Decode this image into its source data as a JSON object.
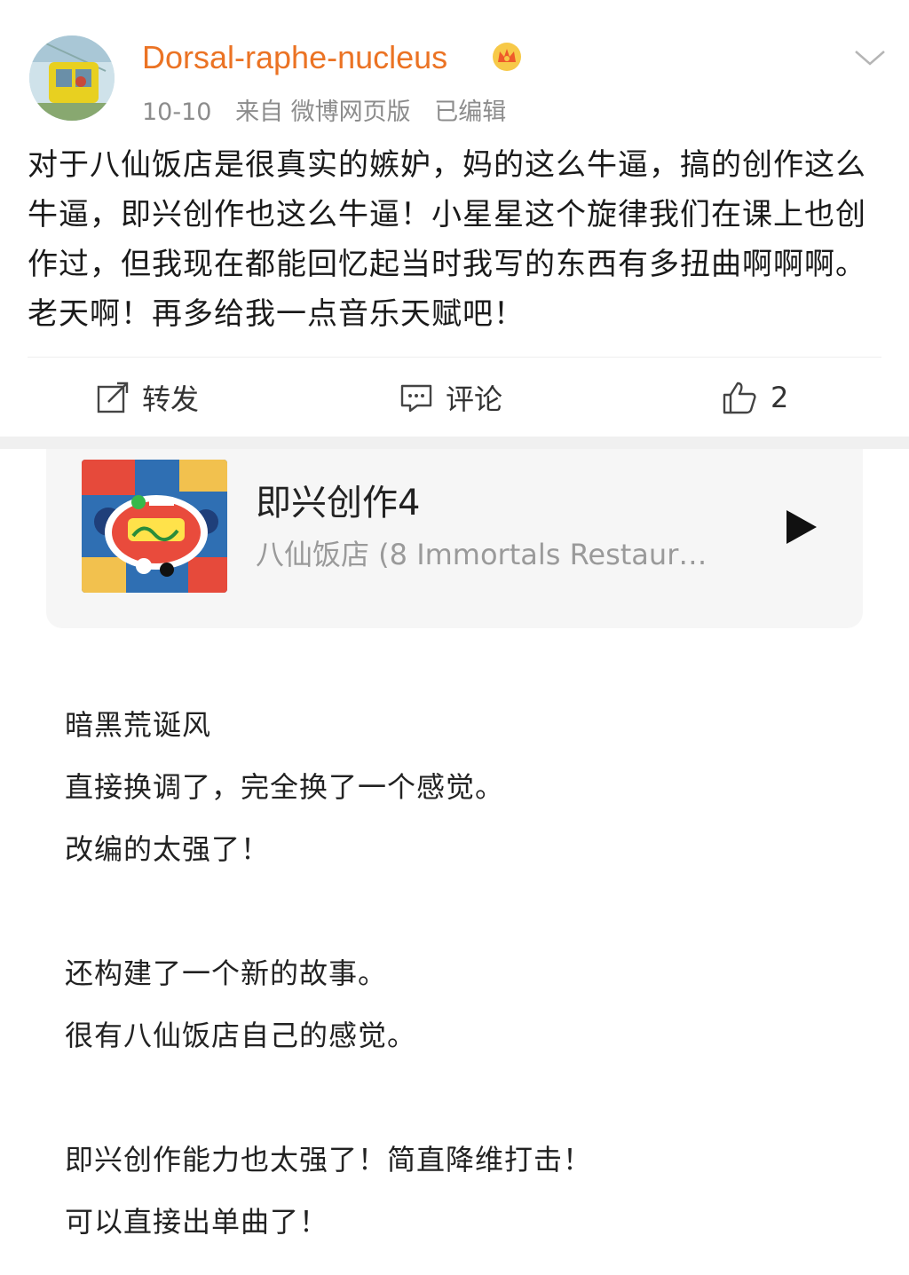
{
  "post": {
    "username": "Dorsal-raphe-nucleus",
    "date": "10-10",
    "source": "来自 微博网页版",
    "edited": "已编辑",
    "text": "对于八仙饭店是很真实的嫉妒，妈的这么牛逼，搞的创作这么牛逼，即兴创作也这么牛逼！小星星这个旋律我们在课上也创作过，但我现在都能回忆起当时我写的东西有多扭曲啊啊啊。老天啊！再多给我一点音乐天赋吧！",
    "actions": {
      "repost_label": "转发",
      "comment_label": "评论",
      "like_count": "2"
    },
    "colors": {
      "username": "#eb7324",
      "meta": "#8c8c8c"
    }
  },
  "music_card": {
    "title": "即兴创作4",
    "subtitle": "八仙饭店 (8 Immortals Restaur…"
  },
  "comment": {
    "lines": [
      "暗黑荒诞风",
      "直接换调了，完全换了一个感觉。",
      "改编的太强了！",
      "",
      "还构建了一个新的故事。",
      "很有八仙饭店自己的感觉。",
      "",
      "即兴创作能力也太强了！简直降维打击！",
      "可以直接出单曲了！"
    ]
  }
}
